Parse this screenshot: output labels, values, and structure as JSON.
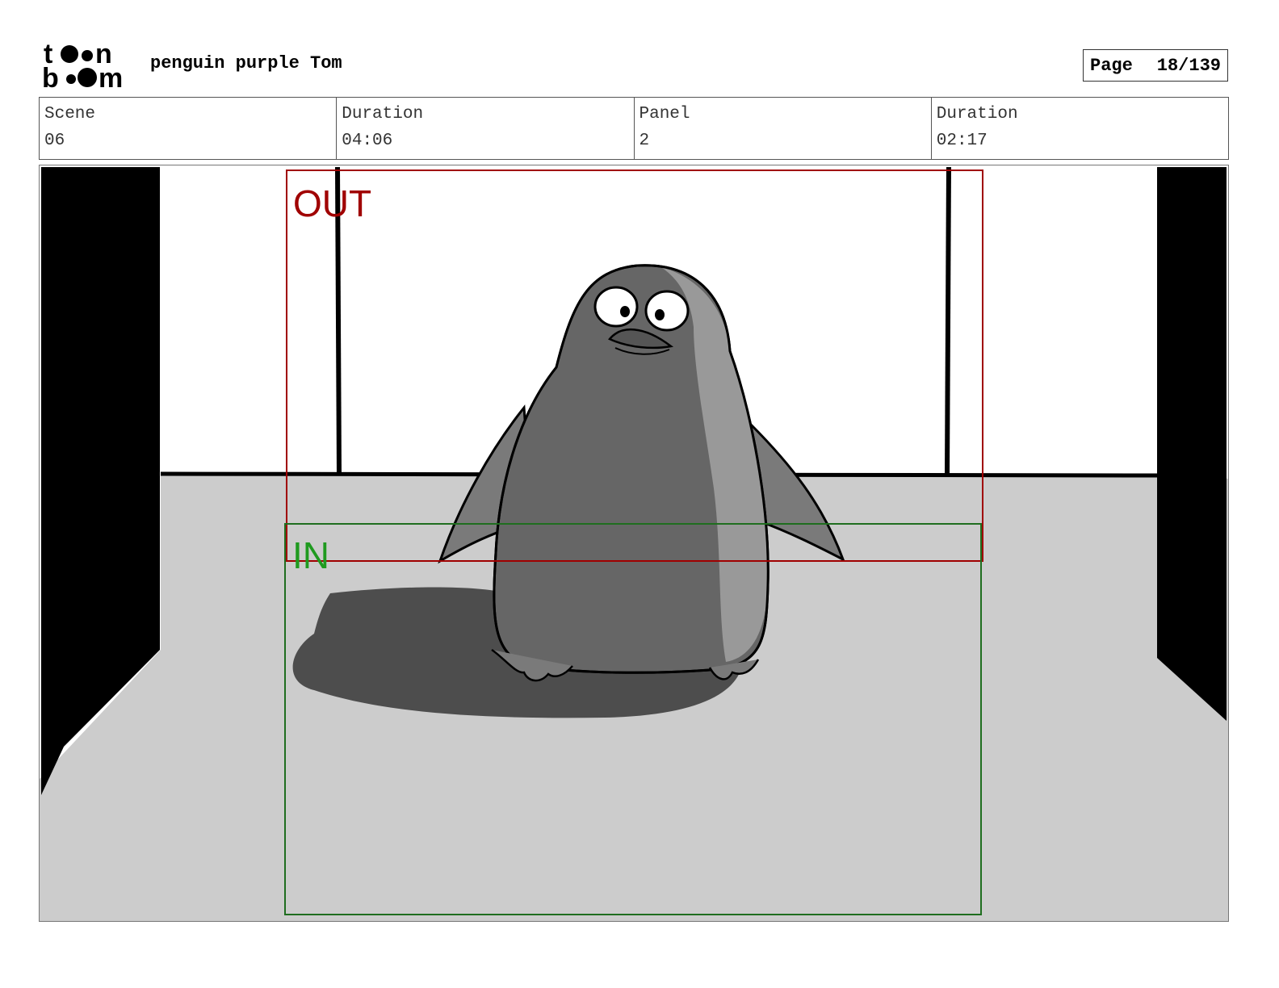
{
  "header": {
    "logo_text": "toon boom",
    "title": "penguin purple Tom",
    "page_label": "Page",
    "page_number": "18/139"
  },
  "info": {
    "scene_label": "Scene",
    "scene_value": "06",
    "scene_duration_label": "Duration",
    "scene_duration_value": "04:06",
    "panel_label": "Panel",
    "panel_value": "2",
    "panel_duration_label": "Duration",
    "panel_duration_value": "02:17"
  },
  "panel_frames": {
    "out_label": "OUT",
    "in_label": "IN",
    "out_color": "#a00000",
    "in_color": "#1f9a1f"
  }
}
